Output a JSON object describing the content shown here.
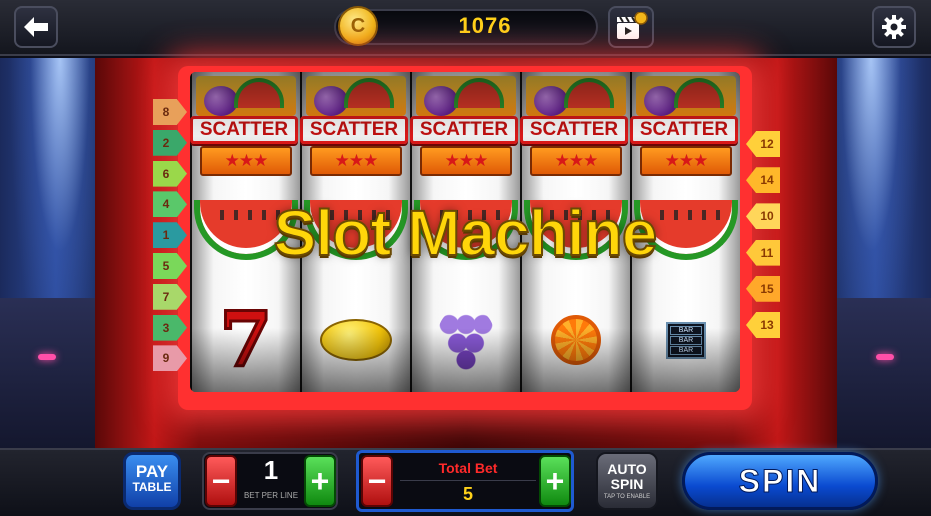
{
  "header": {
    "back_icon": "arrow-left-icon",
    "coin_icon_letter": "C",
    "coin_balance": "1076",
    "video_icon": "clapperboard-coin-icon",
    "settings_icon": "gear-icon"
  },
  "machine": {
    "title": "Slot Machine",
    "reels": [
      {
        "top": "SCATTER",
        "stars": "★★★",
        "bottom": "seven",
        "seven_glyph": "7"
      },
      {
        "top": "SCATTER",
        "stars": "★★★",
        "bottom": "lemon"
      },
      {
        "top": "SCATTER",
        "stars": "★★★",
        "bottom": "grapes"
      },
      {
        "top": "SCATTER",
        "stars": "★★★",
        "bottom": "orange"
      },
      {
        "top": "SCATTER",
        "stars": "★★★",
        "bottom": "bar",
        "bar_lines": [
          "BAR",
          "BAR",
          "BAR"
        ]
      }
    ],
    "paylines_left": [
      {
        "num": "8",
        "color": "#e8a05a"
      },
      {
        "num": "2",
        "color": "#3aa86a"
      },
      {
        "num": "6",
        "color": "#9ad84a"
      },
      {
        "num": "4",
        "color": "#5ac86a"
      },
      {
        "num": "1",
        "color": "#2a9aa0"
      },
      {
        "num": "5",
        "color": "#7ad85a"
      },
      {
        "num": "7",
        "color": "#a8d86a"
      },
      {
        "num": "3",
        "color": "#4ab86a"
      },
      {
        "num": "9",
        "color": "#e89aa8"
      }
    ],
    "paylines_right": [
      {
        "num": "12",
        "color": "#ffd03a"
      },
      {
        "num": "14",
        "color": "#ffb82a"
      },
      {
        "num": "10",
        "color": "#ffd65a"
      },
      {
        "num": "11",
        "color": "#ffc83a"
      },
      {
        "num": "15",
        "color": "#ffa82a"
      },
      {
        "num": "13",
        "color": "#ffd03a"
      }
    ]
  },
  "controls": {
    "paytable_line1": "PAY",
    "paytable_line2": "TABLE",
    "minus_glyph": "−",
    "plus_glyph": "+",
    "bet_per_line_value": "1",
    "bet_per_line_label": "BET PER LINE",
    "total_bet_label": "Total Bet",
    "total_bet_value": "5",
    "autospin_line1": "AUTO",
    "autospin_line2": "SPIN",
    "autospin_hint": "TAP TO ENABLE",
    "spin_label": "SPIN"
  },
  "colors": {
    "coin_text": "#ffd21a",
    "spin_button": "#0a4ad0",
    "frame_red": "#c21818"
  }
}
